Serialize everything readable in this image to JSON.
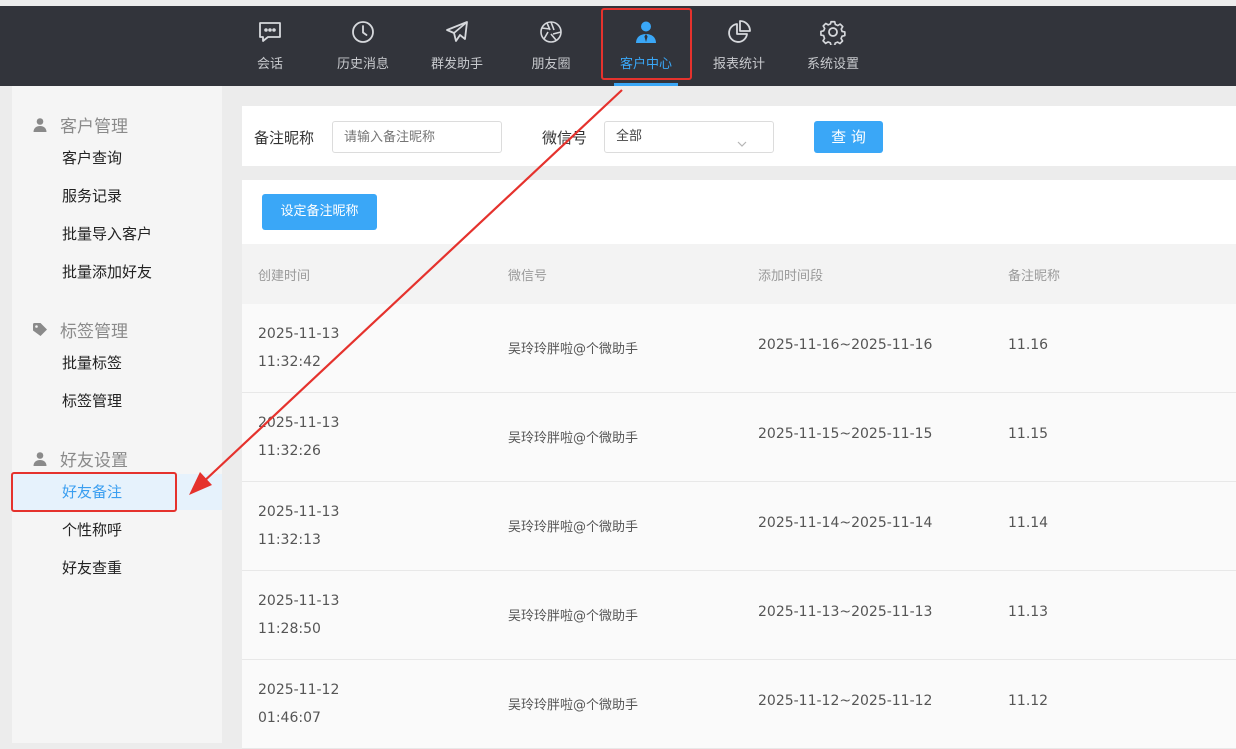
{
  "topnav": {
    "items": [
      {
        "label": "会话",
        "icon": "chat-icon"
      },
      {
        "label": "历史消息",
        "icon": "clock-icon"
      },
      {
        "label": "群发助手",
        "icon": "paper-plane-icon"
      },
      {
        "label": "朋友圈",
        "icon": "aperture-icon"
      },
      {
        "label": "客户中心",
        "icon": "user-tie-icon",
        "active": true
      },
      {
        "label": "报表统计",
        "icon": "pie-chart-icon"
      },
      {
        "label": "系统设置",
        "icon": "gear-icon"
      }
    ],
    "active_color": "#3aa7f7"
  },
  "sidebar": {
    "groups": [
      {
        "title": "客户管理",
        "icon": "user-icon",
        "items": [
          "客户查询",
          "服务记录",
          "批量导入客户",
          "批量添加好友"
        ]
      },
      {
        "title": "标签管理",
        "icon": "tag-icon",
        "items": [
          "批量标签",
          "标签管理"
        ]
      },
      {
        "title": "好友设置",
        "icon": "user-icon",
        "items": [
          "好友备注",
          "个性称呼",
          "好友查重"
        ],
        "active_index": 0
      }
    ]
  },
  "filter": {
    "nickname_label": "备注昵称",
    "nickname_placeholder": "请输入备注昵称",
    "wechat_label": "微信号",
    "wechat_value": "全部",
    "query_button": "查 询"
  },
  "actions": {
    "set_nickname_button": "设定备注昵称"
  },
  "table": {
    "headers": [
      "创建时间",
      "微信号",
      "添加时间段",
      "备注昵称"
    ],
    "rows": [
      {
        "date": "2025-11-13",
        "time": "11:32:42",
        "wechat": "吴玲玲胖啦@个微助手",
        "period": "2025-11-16~2025-11-16",
        "nickname": "11.16"
      },
      {
        "date": "2025-11-13",
        "time": "11:32:26",
        "wechat": "吴玲玲胖啦@个微助手",
        "period": "2025-11-15~2025-11-15",
        "nickname": "11.15"
      },
      {
        "date": "2025-11-13",
        "time": "11:32:13",
        "wechat": "吴玲玲胖啦@个微助手",
        "period": "2025-11-14~2025-11-14",
        "nickname": "11.14"
      },
      {
        "date": "2025-11-13",
        "time": "11:28:50",
        "wechat": "吴玲玲胖啦@个微助手",
        "period": "2025-11-13~2025-11-13",
        "nickname": "11.13"
      },
      {
        "date": "2025-11-12",
        "time": "01:46:07",
        "wechat": "吴玲玲胖啦@个微助手",
        "period": "2025-11-12~2025-11-12",
        "nickname": "11.12"
      }
    ]
  },
  "annotation_color": "#e5322d"
}
